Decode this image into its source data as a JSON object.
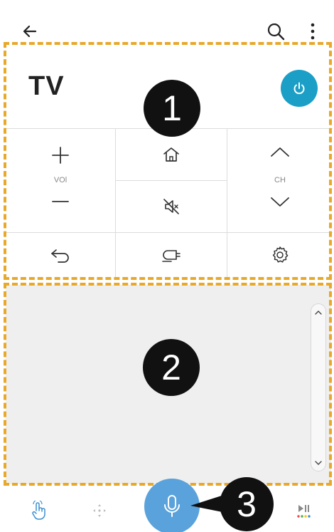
{
  "topbar": {
    "back_icon": "arrow-left-icon",
    "search_icon": "search-icon",
    "more_icon": "more-vertical-icon"
  },
  "remote": {
    "title": "TV",
    "power_icon": "power-icon",
    "volume_label": "VOl",
    "channel_label": "CH",
    "icons": {
      "vol_up": "plus-icon",
      "vol_down": "minus-icon",
      "home": "home-icon",
      "mute": "mute-icon",
      "ch_up": "chevron-up-icon",
      "ch_down": "chevron-down-icon",
      "back": "return-icon",
      "input": "input-source-icon",
      "settings": "gear-icon"
    }
  },
  "callouts": {
    "one": "1",
    "two": "2",
    "three": "3"
  },
  "bottombar": {
    "touch_icon": "hand-touch-icon",
    "pointer_icon": "pointer-dots-icon",
    "mic_icon": "microphone-icon",
    "media_icon": "play-pause-icon"
  },
  "colors": {
    "power": "#1b9fc6",
    "mic": "#5aa2db",
    "guide": "#e8a82a",
    "touchpad": "#efefef"
  }
}
